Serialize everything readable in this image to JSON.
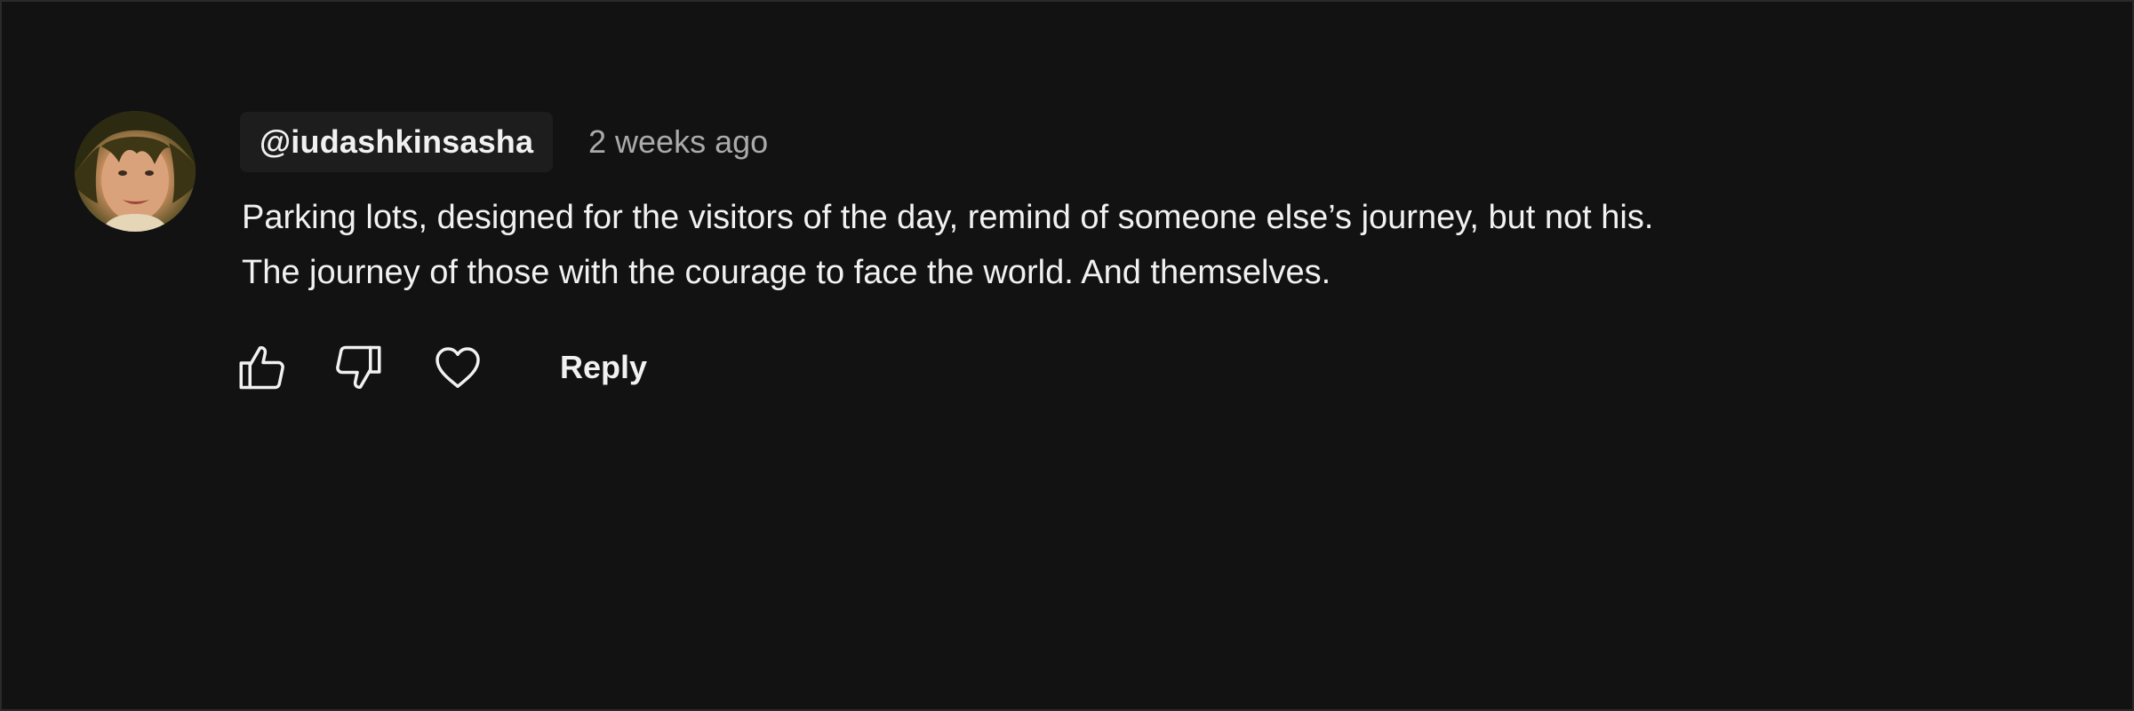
{
  "comment": {
    "author_handle": "@iudashkinsasha",
    "timestamp": "2 weeks ago",
    "body_lines": [
      "Parking lots, designed for the visitors of the day, remind of someone else’s journey, but not his.",
      "The journey of those with the courage to face the world. And themselves."
    ],
    "avatar": "user-avatar-photo",
    "actions": {
      "like_icon": "thumb-up-icon",
      "dislike_icon": "thumb-down-icon",
      "heart_icon": "heart-icon",
      "reply_label": "Reply"
    }
  },
  "colors": {
    "background": "#121212",
    "text_primary": "#f1f1f1",
    "text_secondary": "#aaaaaa",
    "handle_chip_bg": "#1d1d1d"
  }
}
